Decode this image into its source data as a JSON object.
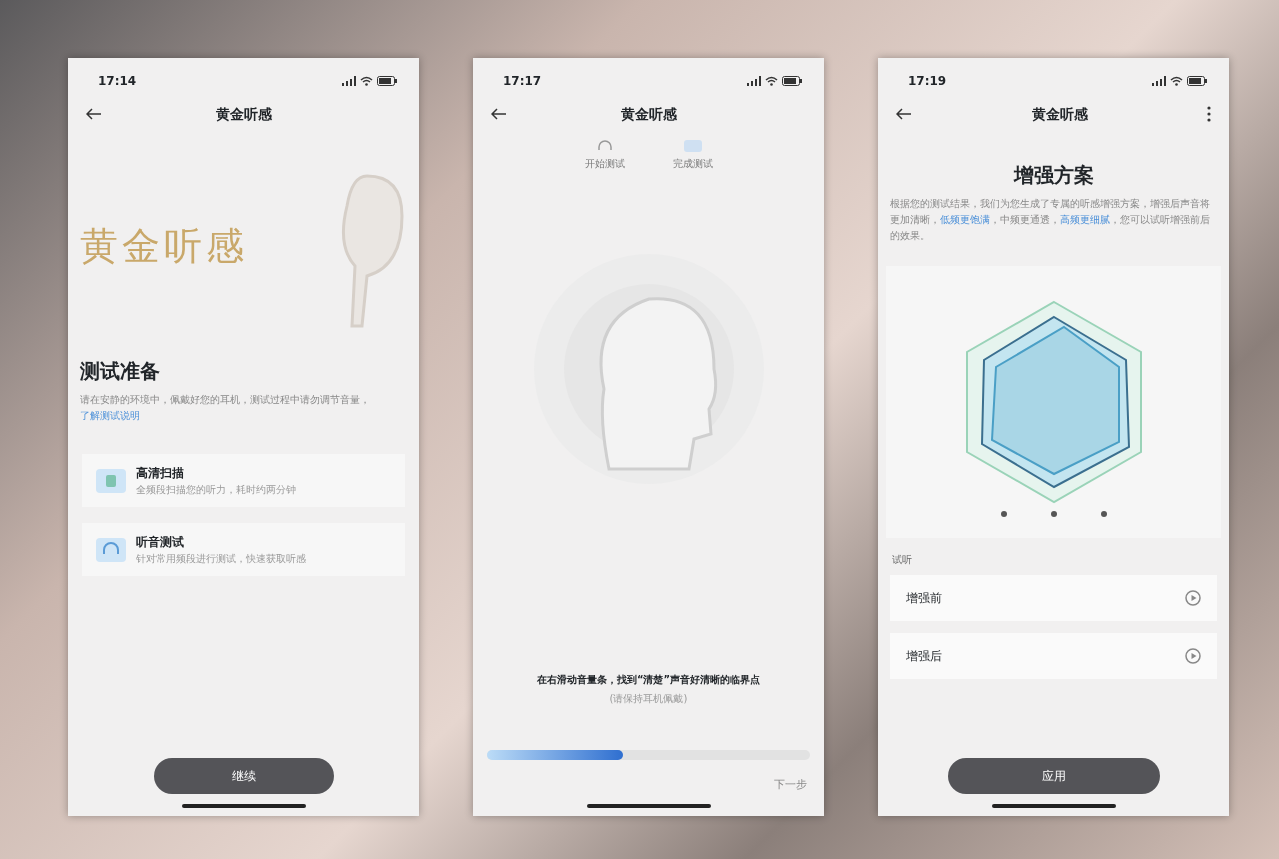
{
  "screens": [
    {
      "kind": "intro",
      "time": "17:14",
      "title": "黄金听感",
      "hero_text": "黄金听感",
      "heading": "测试准备",
      "intro": "请在安静的环境中，佩戴好您的耳机，测试过程中请勿调节音量，",
      "link": "了解测试说明",
      "options": [
        {
          "title": "高清扫描",
          "subtitle": "全频段扫描您的听力，耗时约两分钟"
        },
        {
          "title": "听音测试",
          "subtitle": "针对常用频段进行测试，快速获取听感"
        }
      ],
      "button": "继续"
    },
    {
      "kind": "test",
      "time": "17:17",
      "title": "黄金听感",
      "steps": [
        "开始测试",
        "完成测试"
      ],
      "instruction": "在右滑动音量条，找到“清楚”声音好清晰的临界点",
      "note": "(请保持耳机佩戴)",
      "slider": {
        "level": 0.42
      },
      "next": "下一步"
    },
    {
      "kind": "result",
      "time": "17:19",
      "title": "黄金听感",
      "heading": "增强方案",
      "description": [
        {
          "text": "根据您的测试结果，我们为您生成了专属的听感增强方案，增强后声音将更加清晰，",
          "highlight": false
        },
        {
          "text": "低频更饱满",
          "highlight": true
        },
        {
          "text": "，中频更通透，",
          "highlight": false
        },
        {
          "text": "高频更细腻",
          "highlight": true
        },
        {
          "text": "，您可以试听增强前后的效果。",
          "highlight": false
        }
      ],
      "section_label": "试听",
      "samples": [
        "增强前",
        "增强后"
      ],
      "button": "应用"
    }
  ]
}
